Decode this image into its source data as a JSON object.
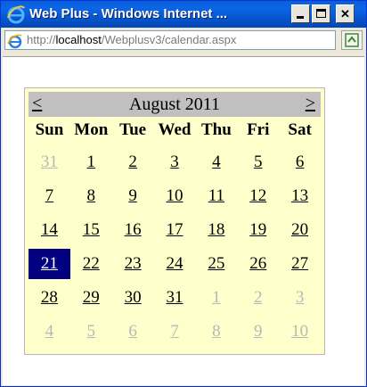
{
  "window": {
    "title": "Web Plus - Windows Internet ..."
  },
  "addressbar": {
    "url_prefix": "http://",
    "url_host": "localhost",
    "url_path": "/Webplusv3/calendar.aspx"
  },
  "icons": {
    "app": "internet-explorer-icon",
    "page": "internet-explorer-page-icon",
    "go": "go-refresh-icon"
  },
  "calendar": {
    "prev_label": "<",
    "next_label": ">",
    "month_label": "August 2011",
    "days_of_week": [
      "Sun",
      "Mon",
      "Tue",
      "Wed",
      "Thu",
      "Fri",
      "Sat"
    ],
    "weeks": [
      [
        {
          "d": "31",
          "other": true
        },
        {
          "d": "1"
        },
        {
          "d": "2"
        },
        {
          "d": "3"
        },
        {
          "d": "4"
        },
        {
          "d": "5"
        },
        {
          "d": "6"
        }
      ],
      [
        {
          "d": "7"
        },
        {
          "d": "8"
        },
        {
          "d": "9"
        },
        {
          "d": "10"
        },
        {
          "d": "11"
        },
        {
          "d": "12"
        },
        {
          "d": "13"
        }
      ],
      [
        {
          "d": "14"
        },
        {
          "d": "15"
        },
        {
          "d": "16"
        },
        {
          "d": "17"
        },
        {
          "d": "18"
        },
        {
          "d": "19"
        },
        {
          "d": "20"
        }
      ],
      [
        {
          "d": "21",
          "selected": true
        },
        {
          "d": "22"
        },
        {
          "d": "23"
        },
        {
          "d": "24"
        },
        {
          "d": "25"
        },
        {
          "d": "26"
        },
        {
          "d": "27"
        }
      ],
      [
        {
          "d": "28"
        },
        {
          "d": "29"
        },
        {
          "d": "30"
        },
        {
          "d": "31"
        },
        {
          "d": "1",
          "other": true
        },
        {
          "d": "2",
          "other": true
        },
        {
          "d": "3",
          "other": true
        }
      ],
      [
        {
          "d": "4",
          "other": true
        },
        {
          "d": "5",
          "other": true
        },
        {
          "d": "6",
          "other": true
        },
        {
          "d": "7",
          "other": true
        },
        {
          "d": "8",
          "other": true
        },
        {
          "d": "9",
          "other": true
        },
        {
          "d": "10",
          "other": true
        }
      ]
    ],
    "colors": {
      "background": "#ffffcc",
      "header": "#c0c0c0",
      "selected": "#000080",
      "other_month": "#b8b8b8"
    }
  }
}
